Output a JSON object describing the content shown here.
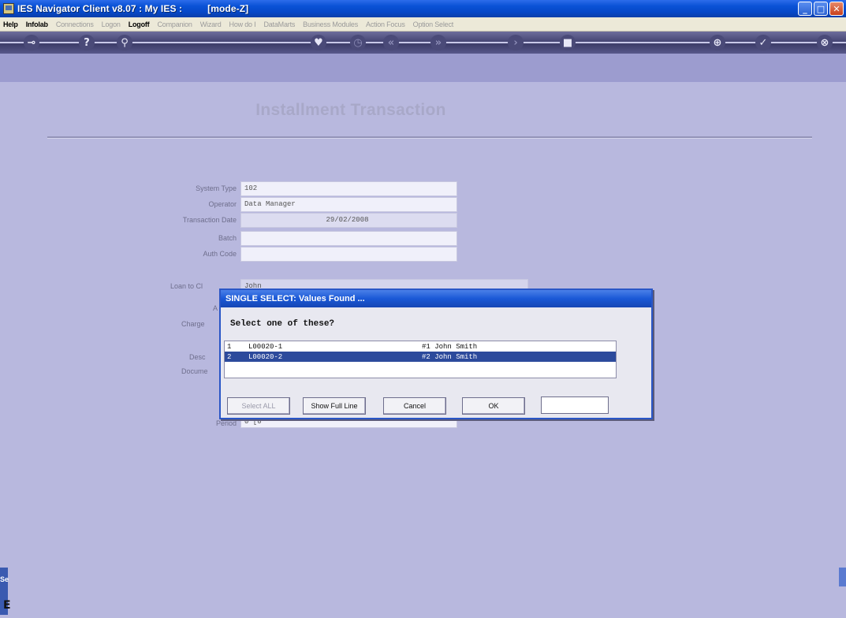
{
  "window": {
    "title": "IES Navigator Client v8.07 : My IES :",
    "mode": "[mode-Z]",
    "colors": {
      "titlebar": "#0a52d6",
      "background": "#b8b8de",
      "selection": "#2c4a9c"
    }
  },
  "menu": {
    "items": [
      {
        "label": "Help",
        "active": true
      },
      {
        "label": "Infolab",
        "active": true
      },
      {
        "label": "Connections",
        "active": false
      },
      {
        "label": "Logon",
        "active": false
      },
      {
        "label": "Logoff",
        "active": true
      },
      {
        "label": "Companion",
        "active": false
      },
      {
        "label": "Wizard",
        "active": false
      },
      {
        "label": "How do I",
        "active": false
      },
      {
        "label": "DataMarts",
        "active": false
      },
      {
        "label": "Business Modules",
        "active": false
      },
      {
        "label": "Action Focus",
        "active": false
      },
      {
        "label": "Option Select",
        "active": false
      }
    ]
  },
  "toolbar": {
    "icons": [
      "key-icon",
      "help-icon",
      "search-icon",
      "heart-icon",
      "clock-icon",
      "rewind-icon",
      "forward-icon",
      "next-icon",
      "stop-icon",
      "add-icon",
      "check-icon",
      "close-icon"
    ]
  },
  "form": {
    "title": "Installment Transaction",
    "fields": [
      {
        "label": "System Type",
        "value": "102"
      },
      {
        "label": "Operator",
        "value": "Data Manager"
      },
      {
        "label": "Transaction Date",
        "value": "29/02/2008"
      },
      {
        "label": "Batch",
        "value": ""
      },
      {
        "label": "Auth Code",
        "value": ""
      }
    ],
    "partial_labels": [
      {
        "label": "Loan to Cl",
        "value": "John"
      },
      {
        "label": "A",
        "value": ""
      },
      {
        "label": "Charge",
        "value": ""
      },
      {
        "label": "Desc",
        "value": ""
      },
      {
        "label": "Docume",
        "value": ""
      },
      {
        "label": "Period",
        "value": "0 [0 "
      }
    ]
  },
  "dialog": {
    "title": "SINGLE SELECT: Values Found ...",
    "prompt": "Select one of these?",
    "rows": [
      {
        "num": "1",
        "code": "L00020-1",
        "name": "#1 John Smith",
        "selected": false
      },
      {
        "num": "2",
        "code": "L00020-2",
        "name": "#2 John Smith",
        "selected": true
      }
    ],
    "buttons": {
      "select_all": "Select ALL",
      "show_full_line": "Show Full Line",
      "cancel": "Cancel",
      "ok": "OK"
    },
    "input_value": ""
  },
  "side": {
    "left_tab": "Se",
    "left_glyph": "E"
  }
}
